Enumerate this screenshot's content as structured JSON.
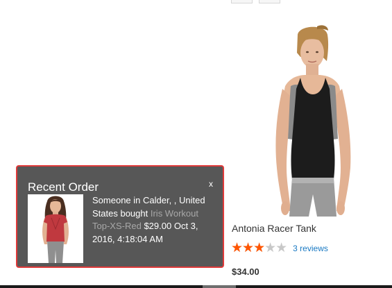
{
  "product": {
    "name": "Antonia Racer Tank",
    "rating_percent": 60,
    "stars": "★★★★★",
    "reviews_label": "3 reviews",
    "price": "$34.00"
  },
  "popup": {
    "title": "Recent Order",
    "close_label": "x",
    "message_prefix": "Someone in Calder, , United States bought",
    "product_link": "Iris Workout Top-XS-Red",
    "price": "$29.00",
    "date": "Oct 3, 2016, 4:18:04 AM"
  },
  "colors": {
    "star_fill": "#ff5501",
    "star_empty": "#c8c8c8",
    "reviews_link": "#1979c3",
    "popup_bg": "#575757",
    "popup_border": "#e03a3a",
    "popup_link": "#a8a8a8"
  }
}
